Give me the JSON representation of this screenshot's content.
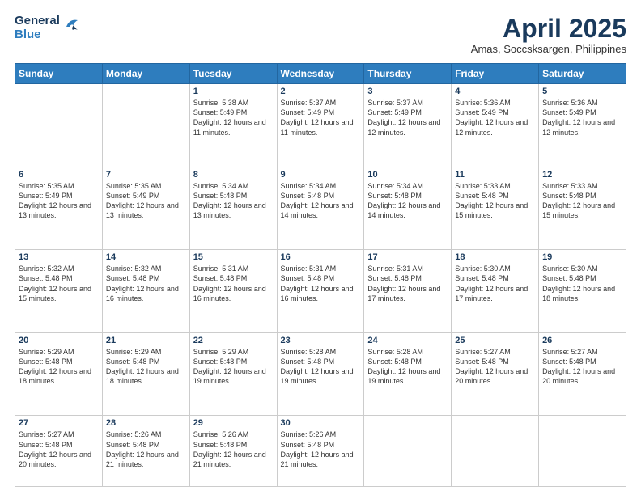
{
  "logo": {
    "general": "General",
    "blue": "Blue"
  },
  "title": "April 2025",
  "location": "Amas, Soccsksargen, Philippines",
  "weekdays": [
    "Sunday",
    "Monday",
    "Tuesday",
    "Wednesday",
    "Thursday",
    "Friday",
    "Saturday"
  ],
  "weeks": [
    [
      {
        "day": "",
        "info": ""
      },
      {
        "day": "",
        "info": ""
      },
      {
        "day": "1",
        "info": "Sunrise: 5:38 AM\nSunset: 5:49 PM\nDaylight: 12 hours and 11 minutes."
      },
      {
        "day": "2",
        "info": "Sunrise: 5:37 AM\nSunset: 5:49 PM\nDaylight: 12 hours and 11 minutes."
      },
      {
        "day": "3",
        "info": "Sunrise: 5:37 AM\nSunset: 5:49 PM\nDaylight: 12 hours and 12 minutes."
      },
      {
        "day": "4",
        "info": "Sunrise: 5:36 AM\nSunset: 5:49 PM\nDaylight: 12 hours and 12 minutes."
      },
      {
        "day": "5",
        "info": "Sunrise: 5:36 AM\nSunset: 5:49 PM\nDaylight: 12 hours and 12 minutes."
      }
    ],
    [
      {
        "day": "6",
        "info": "Sunrise: 5:35 AM\nSunset: 5:49 PM\nDaylight: 12 hours and 13 minutes."
      },
      {
        "day": "7",
        "info": "Sunrise: 5:35 AM\nSunset: 5:49 PM\nDaylight: 12 hours and 13 minutes."
      },
      {
        "day": "8",
        "info": "Sunrise: 5:34 AM\nSunset: 5:48 PM\nDaylight: 12 hours and 13 minutes."
      },
      {
        "day": "9",
        "info": "Sunrise: 5:34 AM\nSunset: 5:48 PM\nDaylight: 12 hours and 14 minutes."
      },
      {
        "day": "10",
        "info": "Sunrise: 5:34 AM\nSunset: 5:48 PM\nDaylight: 12 hours and 14 minutes."
      },
      {
        "day": "11",
        "info": "Sunrise: 5:33 AM\nSunset: 5:48 PM\nDaylight: 12 hours and 15 minutes."
      },
      {
        "day": "12",
        "info": "Sunrise: 5:33 AM\nSunset: 5:48 PM\nDaylight: 12 hours and 15 minutes."
      }
    ],
    [
      {
        "day": "13",
        "info": "Sunrise: 5:32 AM\nSunset: 5:48 PM\nDaylight: 12 hours and 15 minutes."
      },
      {
        "day": "14",
        "info": "Sunrise: 5:32 AM\nSunset: 5:48 PM\nDaylight: 12 hours and 16 minutes."
      },
      {
        "day": "15",
        "info": "Sunrise: 5:31 AM\nSunset: 5:48 PM\nDaylight: 12 hours and 16 minutes."
      },
      {
        "day": "16",
        "info": "Sunrise: 5:31 AM\nSunset: 5:48 PM\nDaylight: 12 hours and 16 minutes."
      },
      {
        "day": "17",
        "info": "Sunrise: 5:31 AM\nSunset: 5:48 PM\nDaylight: 12 hours and 17 minutes."
      },
      {
        "day": "18",
        "info": "Sunrise: 5:30 AM\nSunset: 5:48 PM\nDaylight: 12 hours and 17 minutes."
      },
      {
        "day": "19",
        "info": "Sunrise: 5:30 AM\nSunset: 5:48 PM\nDaylight: 12 hours and 18 minutes."
      }
    ],
    [
      {
        "day": "20",
        "info": "Sunrise: 5:29 AM\nSunset: 5:48 PM\nDaylight: 12 hours and 18 minutes."
      },
      {
        "day": "21",
        "info": "Sunrise: 5:29 AM\nSunset: 5:48 PM\nDaylight: 12 hours and 18 minutes."
      },
      {
        "day": "22",
        "info": "Sunrise: 5:29 AM\nSunset: 5:48 PM\nDaylight: 12 hours and 19 minutes."
      },
      {
        "day": "23",
        "info": "Sunrise: 5:28 AM\nSunset: 5:48 PM\nDaylight: 12 hours and 19 minutes."
      },
      {
        "day": "24",
        "info": "Sunrise: 5:28 AM\nSunset: 5:48 PM\nDaylight: 12 hours and 19 minutes."
      },
      {
        "day": "25",
        "info": "Sunrise: 5:27 AM\nSunset: 5:48 PM\nDaylight: 12 hours and 20 minutes."
      },
      {
        "day": "26",
        "info": "Sunrise: 5:27 AM\nSunset: 5:48 PM\nDaylight: 12 hours and 20 minutes."
      }
    ],
    [
      {
        "day": "27",
        "info": "Sunrise: 5:27 AM\nSunset: 5:48 PM\nDaylight: 12 hours and 20 minutes."
      },
      {
        "day": "28",
        "info": "Sunrise: 5:26 AM\nSunset: 5:48 PM\nDaylight: 12 hours and 21 minutes."
      },
      {
        "day": "29",
        "info": "Sunrise: 5:26 AM\nSunset: 5:48 PM\nDaylight: 12 hours and 21 minutes."
      },
      {
        "day": "30",
        "info": "Sunrise: 5:26 AM\nSunset: 5:48 PM\nDaylight: 12 hours and 21 minutes."
      },
      {
        "day": "",
        "info": ""
      },
      {
        "day": "",
        "info": ""
      },
      {
        "day": "",
        "info": ""
      }
    ]
  ]
}
